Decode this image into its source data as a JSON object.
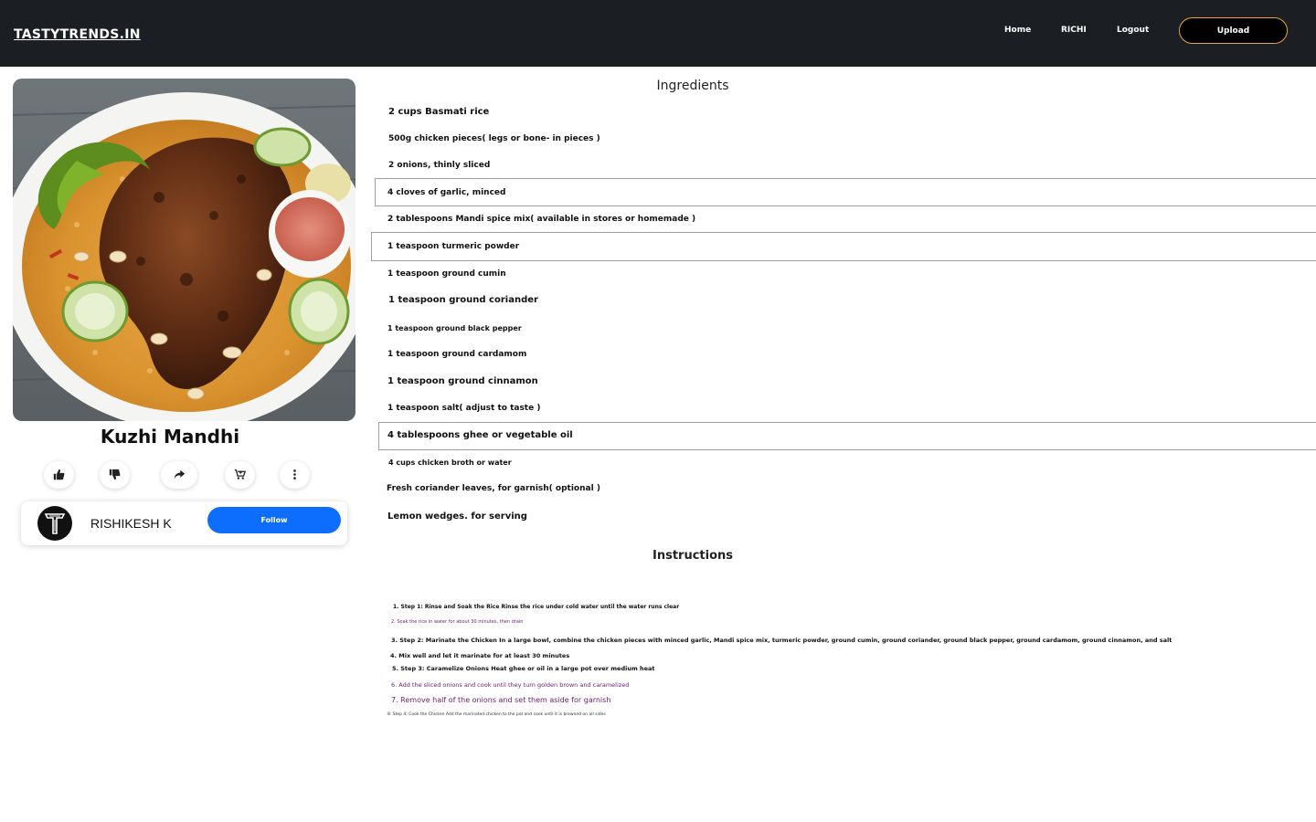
{
  "header": {
    "brand": "TASTYTRENDS.IN",
    "nav": {
      "home": "Home",
      "user": "RICHI",
      "logout": "Logout"
    },
    "upload_label": "Upload",
    "background_color": "#1b1e22",
    "upload_border_color": "#e8a442"
  },
  "recipe": {
    "title": "Kuzhi Mandhi",
    "image_alt": "Kuzhi Mandhi plated chicken over rice",
    "actions": [
      "thumbs-up-icon",
      "thumbs-down-icon",
      "share-icon",
      "cart-icon",
      "more-vertical-icon"
    ]
  },
  "author": {
    "name": "RISHIKESH K",
    "follow_label": "Follow",
    "follow_color": "#0d6efd"
  },
  "ingredients": {
    "heading": "Ingredients",
    "items": [
      "2 cups Basmati rice",
      "500g chicken pieces( legs or bone- in pieces )",
      "2 onions, thinly sliced",
      "4 cloves of garlic, minced",
      "2 tablespoons Mandi spice mix( available in stores or homemade )",
      "1 teaspoon turmeric powder",
      "1 teaspoon ground cumin",
      "1 teaspoon ground coriander",
      "1 teaspoon ground black pepper",
      "1 teaspoon ground cardamom",
      "1 teaspoon ground cinnamon",
      "1 teaspoon salt( adjust to taste )",
      "4 tablespoons ghee or vegetable oil",
      "4 cups chicken broth or water",
      "Fresh coriander leaves, for garnish( optional )",
      "Lemon wedges. for serving"
    ]
  },
  "instructions": {
    "heading": "Instructions",
    "steps": [
      "1. Step 1: Rinse and Soak the Rice Rinse the rice under cold water until the water runs clear",
      "2. Soak the rice in water for about 30 minutes, then drain",
      "3. Step 2: Marinate the Chicken In a large bowl, combine the chicken pieces with minced garlic, Mandi spice mix, turmeric powder, ground cumin, ground coriander, ground black pepper, ground cardamom, ground cinnamon, and salt",
      "4. Mix well and let it marinate for at least 30 minutes",
      "5. Step 3: Caramelize Onions Heat ghee or oil in a large pot over medium heat",
      "6. Add the sliced onions and cook until they turn golden brown and caramelized",
      "7. Remove half of the onions and set them aside for garnish",
      "8. Step 4: Cook the Chicken Add the marinated chicken to the pot and cook until it is browned on all sides"
    ],
    "accent_color": "#6a1b6e"
  }
}
